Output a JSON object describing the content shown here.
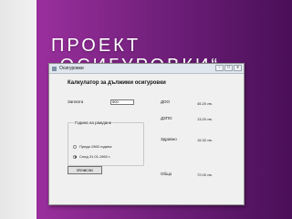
{
  "slide": {
    "title": "ПРОЕКТ „ОСИГУРОВКИ“"
  },
  "window": {
    "title": "Осигуровки",
    "controls": [
      "-",
      "□",
      "x"
    ],
    "heading": "Калкулатор за дължими осигуровки",
    "salary": {
      "label": "Заплата",
      "value": "500"
    },
    "results": [
      {
        "label": "ДОО",
        "value": "45.20 лв."
      },
      {
        "label": "ДЗПО",
        "value": "13.20 лв."
      },
      {
        "label": "Здравно",
        "value": "15.32 лв."
      },
      {
        "label": "Общо",
        "value": "72.00 лв."
      }
    ],
    "birth_group": {
      "title": "Година на раждане",
      "options": [
        "Преди 1960 година",
        "След 31.01.1960 г."
      ],
      "selected_index": 1
    },
    "calculate_button": "Изчисли"
  }
}
